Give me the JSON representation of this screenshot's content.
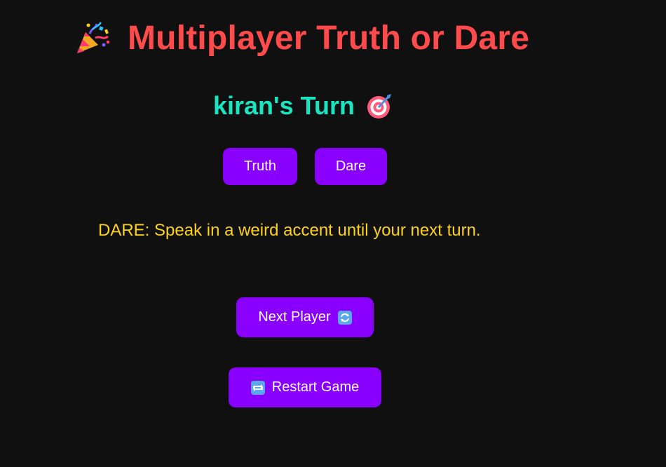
{
  "header": {
    "icon": "party-popper-icon",
    "title": "Multiplayer Truth or Dare"
  },
  "turn": {
    "label": "kiran's Turn",
    "icon": "target-dart-icon"
  },
  "choices": {
    "truth_label": "Truth",
    "dare_label": "Dare"
  },
  "prompt": {
    "text": "DARE: Speak in a weird accent until your next turn."
  },
  "actions": {
    "next_player_label": "Next Player",
    "next_player_icon": "cycle-arrows-icon",
    "restart_label": "Restart Game",
    "restart_icon": "repeat-icon"
  },
  "colors": {
    "background": "#101010",
    "title": "#ff4b4b",
    "turn": "#19e6c1",
    "button": "#8a00ff",
    "prompt": "#ffd21a"
  }
}
